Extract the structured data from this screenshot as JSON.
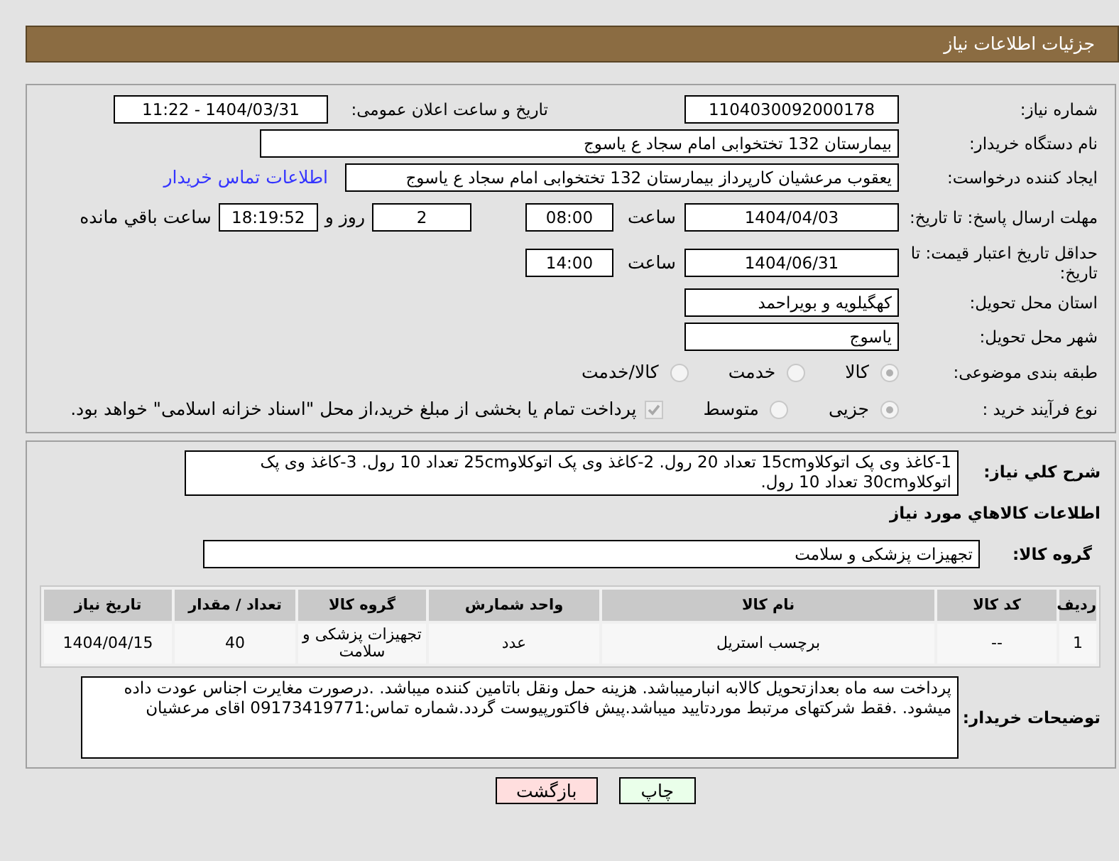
{
  "header": {
    "title": "جزئیات اطلاعات نیاز"
  },
  "need_number": {
    "label": "شماره نیاز:",
    "value": "1104030092000178"
  },
  "announce": {
    "label": "تاریخ و ساعت اعلان عمومی:",
    "value": "1404/03/31 - 11:22"
  },
  "buyer": {
    "label": "نام دستگاه خریدار:",
    "value": "بیمارستان 132 تختخوابی امام سجاد  ع  یاسوج"
  },
  "requester": {
    "label": "ایجاد کننده درخواست:",
    "value": "یعقوب مرعشیان کارپرداز بیمارستان 132 تختخوابی امام سجاد  ع  یاسوج",
    "link": "اطلاعات تماس خریدار"
  },
  "deadline": {
    "label": "مهلت ارسال پاسخ: تا تاریخ:",
    "date": "1404/04/03",
    "time_label": "ساعت",
    "time": "08:00",
    "days": "2",
    "days_suffix": "روز و",
    "remaining": "18:19:52",
    "remaining_suffix": "ساعت باقي مانده"
  },
  "validity": {
    "label": "حداقل تاریخ اعتبار قیمت: تا تاریخ:",
    "date": "1404/06/31",
    "time_label": "ساعت",
    "time": "14:00"
  },
  "province": {
    "label": "استان محل تحویل:",
    "value": "کهگیلویه و بویراحمد"
  },
  "city": {
    "label": "شهر محل تحویل:",
    "value": "یاسوج"
  },
  "category": {
    "label": "طبقه بندی موضوعی:",
    "options": [
      {
        "label": "کالا",
        "selected": true
      },
      {
        "label": "خدمت",
        "selected": false
      },
      {
        "label": "کالا/خدمت",
        "selected": false
      }
    ]
  },
  "process": {
    "label": "نوع فرآیند خرید :",
    "options": [
      {
        "label": "جزیی",
        "selected": true
      },
      {
        "label": "متوسط",
        "selected": false
      }
    ],
    "checkbox": {
      "checked": true,
      "text": "پرداخت تمام یا بخشی از مبلغ خرید،از محل \"اسناد خزانه اسلامی\" خواهد بود."
    }
  },
  "description": {
    "label": "شرح کلي نياز:",
    "value": "1-کاغذ وی پک اتوکلاو15cm تعداد 20 رول.      2-کاغذ وی پک اتوکلاو25cm تعداد 10 رول.      3-کاغذ وی پک اتوکلاو30cm تعداد 10 رول."
  },
  "goods_title": "اطلاعات کالاهاي مورد نياز",
  "group": {
    "label": "گروه کالا:",
    "value": "تجهیزات پزشکی و سلامت"
  },
  "table": {
    "columns": [
      "ردیف",
      "کد کالا",
      "نام کالا",
      "واحد شمارش",
      "گروه کالا",
      "تعداد / مقدار",
      "تاریخ نیاز"
    ],
    "rows": [
      [
        "1",
        "--",
        "برچسب استریل",
        "عدد",
        "تجهیزات پزشکی و سلامت",
        "40",
        "1404/04/15"
      ]
    ]
  },
  "buyer_notes": {
    "label": "توضیحات خریدار:",
    "value": "پرداخت سه ماه بعدازتحویل کالابه انبارمیباشد. هزینه حمل ونقل باتامین کننده میباشد. .درصورت مغایرت اجناس عودت داده میشود. .فقط شرکتهای مرتبط موردتایید میباشد.پیش فاکتورپیوست گردد.شماره تماس:09173419771 اقای مرعشیان"
  },
  "buttons": [
    {
      "label": "چاپ",
      "kind": "print"
    },
    {
      "label": "بازگشت",
      "kind": "back"
    }
  ]
}
